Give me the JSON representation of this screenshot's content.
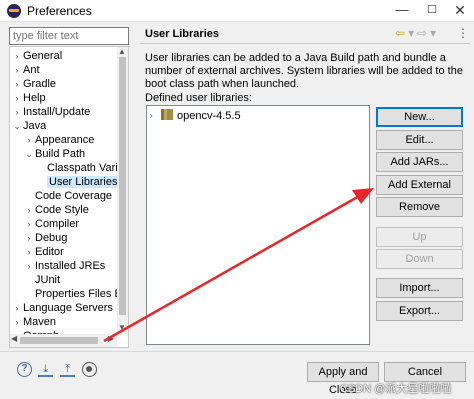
{
  "window": {
    "title": "Preferences",
    "minimize": "—",
    "maximize": "☐",
    "close": "✕"
  },
  "filter": {
    "placeholder": "type filter text"
  },
  "tree": [
    {
      "label": "General",
      "chevron": "›"
    },
    {
      "label": "Ant",
      "chevron": "›"
    },
    {
      "label": "Gradle",
      "chevron": "›"
    },
    {
      "label": "Help",
      "chevron": "›"
    },
    {
      "label": "Install/Update",
      "chevron": "›"
    },
    {
      "label": "Java",
      "chevron": "⌄"
    },
    {
      "label": "Appearance",
      "chevron": "›"
    },
    {
      "label": "Build Path",
      "chevron": "⌄"
    },
    {
      "label": "Classpath Variab",
      "chevron": ""
    },
    {
      "label": "User Libraries",
      "chevron": ""
    },
    {
      "label": "Code Coverage",
      "chevron": ""
    },
    {
      "label": "Code Style",
      "chevron": "›"
    },
    {
      "label": "Compiler",
      "chevron": "›"
    },
    {
      "label": "Debug",
      "chevron": "›"
    },
    {
      "label": "Editor",
      "chevron": "›"
    },
    {
      "label": "Installed JREs",
      "chevron": "›"
    },
    {
      "label": "JUnit",
      "chevron": ""
    },
    {
      "label": "Properties Files Edi",
      "chevron": ""
    },
    {
      "label": "Language Servers",
      "chevron": "›"
    },
    {
      "label": "Maven",
      "chevron": "›"
    },
    {
      "label": "Oomph",
      "chevron": "›"
    }
  ],
  "right": {
    "title": "User Libraries",
    "nav_back": "⇦",
    "nav_back_menu": "▾",
    "nav_fwd": "⇨",
    "nav_fwd_menu": "▾",
    "menu": "⋮",
    "description": "User libraries can be added to a Java Build path and bundle a number of external archives. System libraries will be added to the boot class path when launched.",
    "defined_label": "Defined user libraries:",
    "libraries": [
      {
        "name": "opencv-4.5.5"
      }
    ]
  },
  "buttons": {
    "new": "New...",
    "edit": "Edit...",
    "add_jars": "Add JARs...",
    "add_external_jars": "Add External JARs...",
    "remove": "Remove",
    "up": "Up",
    "down": "Down",
    "import": "Import...",
    "export": "Export..."
  },
  "footer": {
    "apply_close": "Apply and Close",
    "cancel": "Cancel",
    "watermark": "CSDN @派大星啦啦啦"
  },
  "colors": {
    "selection": "#cce8ff",
    "annotation_arrow": "#e8262a",
    "primary_border": "#0078d7"
  }
}
